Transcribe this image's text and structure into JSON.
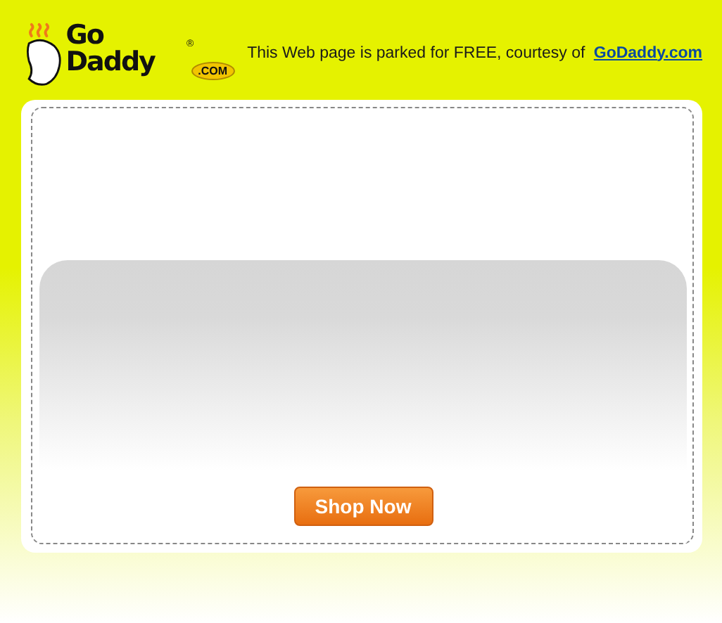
{
  "logo": {
    "wordmark": "Go Daddy",
    "registered": "®",
    "suffix": ".COM"
  },
  "header": {
    "message": "This Web page is parked for FREE, courtesy of",
    "link": "GoDaddy.com"
  },
  "button": {
    "label": "Shop Now"
  }
}
